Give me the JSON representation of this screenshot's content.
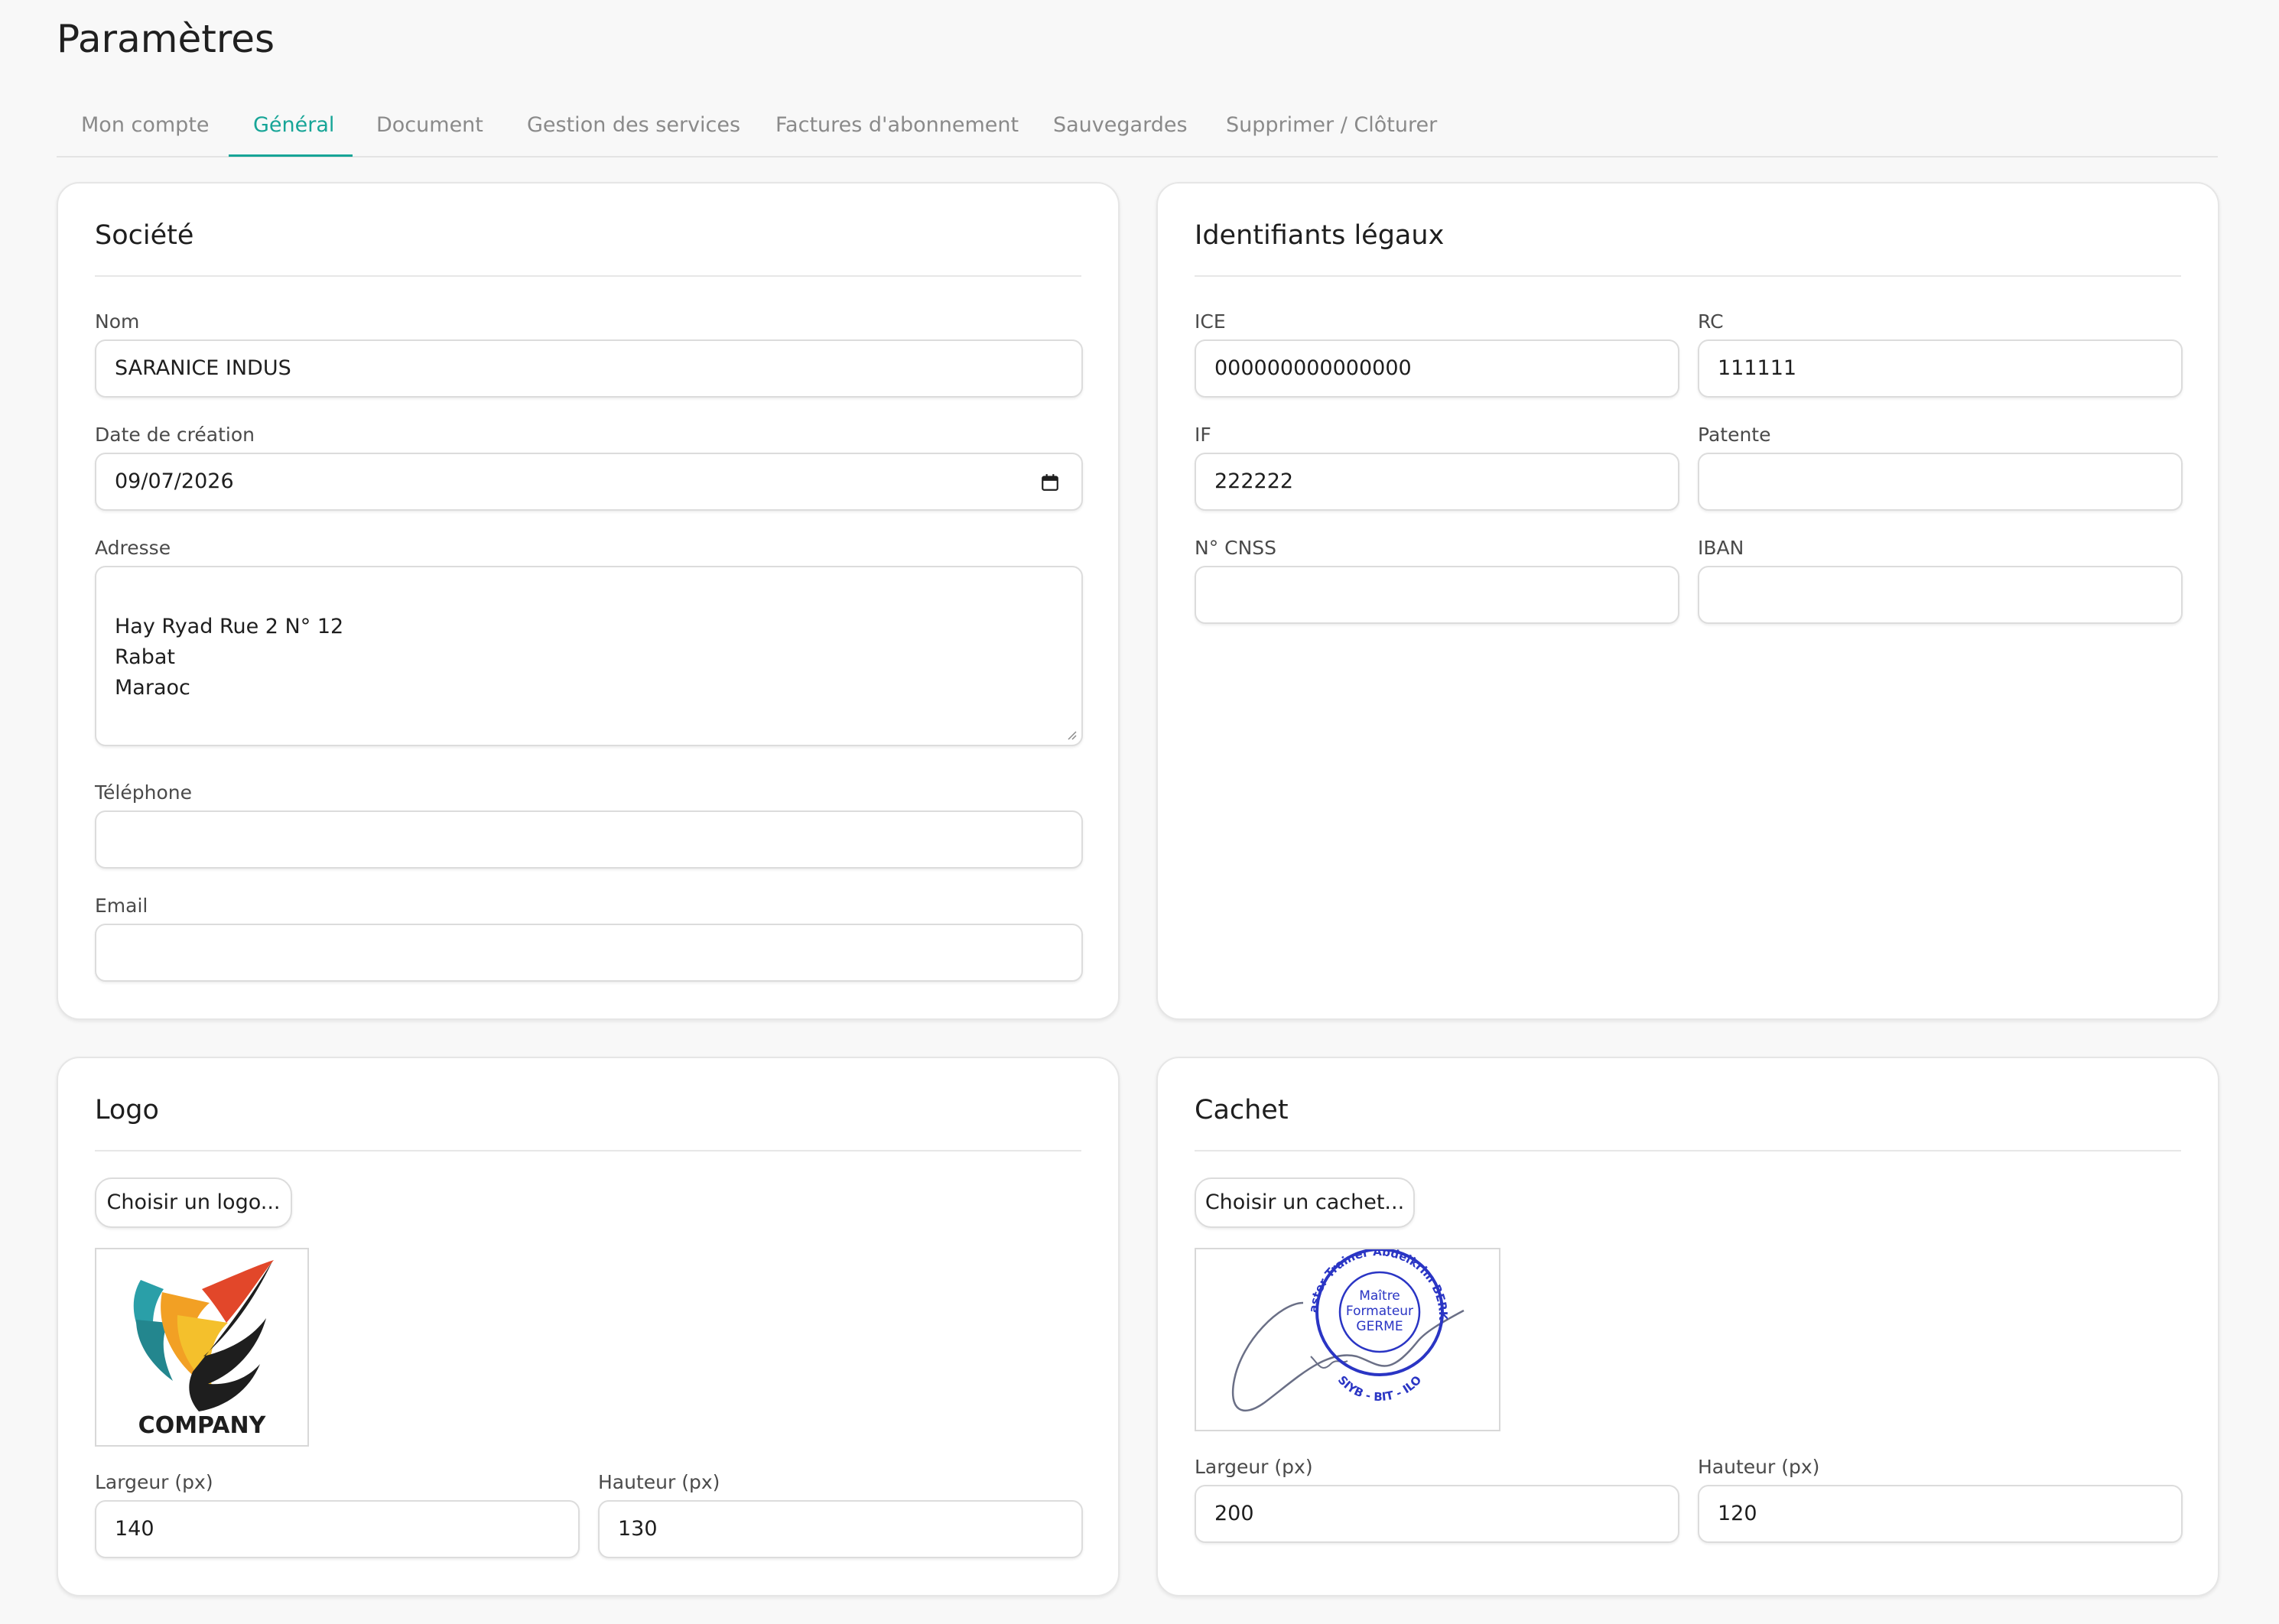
{
  "page": {
    "title": "Paramètres"
  },
  "tabs": [
    {
      "label": "Mon compte",
      "active": false
    },
    {
      "label": "Général",
      "active": true
    },
    {
      "label": "Document",
      "active": false
    },
    {
      "label": "Gestion des services",
      "active": false
    },
    {
      "label": "Factures d'abonnement",
      "active": false
    },
    {
      "label": "Sauvegardes",
      "active": false
    },
    {
      "label": "Supprimer / Clôturer",
      "active": false
    }
  ],
  "colors": {
    "accent": "#17a597",
    "background": "#f8f8f8",
    "card": "#ffffff"
  },
  "societe": {
    "title": "Société",
    "nom": {
      "label": "Nom",
      "value": "SARANICE INDUS"
    },
    "date_creation": {
      "label": "Date de création",
      "value": "09/07/2026",
      "icon": "calendar-icon"
    },
    "adresse": {
      "label": "Adresse",
      "value": "Hay Ryad Rue 2 N° 12\nRabat\nMaraoc"
    },
    "telephone": {
      "label": "Téléphone",
      "value": ""
    },
    "email": {
      "label": "Email",
      "value": ""
    }
  },
  "identifiants": {
    "title": "Identifiants légaux",
    "ice": {
      "label": "ICE",
      "value": "000000000000000"
    },
    "rc": {
      "label": "RC",
      "value": "111111"
    },
    "if": {
      "label": "IF",
      "value": "222222"
    },
    "patente": {
      "label": "Patente",
      "value": ""
    },
    "cnss": {
      "label": "N° CNSS",
      "value": ""
    },
    "iban": {
      "label": "IBAN",
      "value": ""
    }
  },
  "logo": {
    "title": "Logo",
    "button": "Choisir un logo...",
    "image_text": "COMPANY",
    "largeur": {
      "label": "Largeur (px)",
      "value": "140"
    },
    "hauteur": {
      "label": "Hauteur (px)",
      "value": "130"
    }
  },
  "cachet": {
    "title": "Cachet",
    "button": "Choisir un cachet...",
    "stamp_ring_text": "Master Trainer Abdelkrim BERKI",
    "stamp_center_line1": "Maître",
    "stamp_center_line2": "Formateur",
    "stamp_center_line3": "GERME",
    "stamp_bottom_text": "SIYB - BIT - ILO",
    "largeur": {
      "label": "Largeur (px)",
      "value": "200"
    },
    "hauteur": {
      "label": "Hauteur (px)",
      "value": "120"
    }
  }
}
